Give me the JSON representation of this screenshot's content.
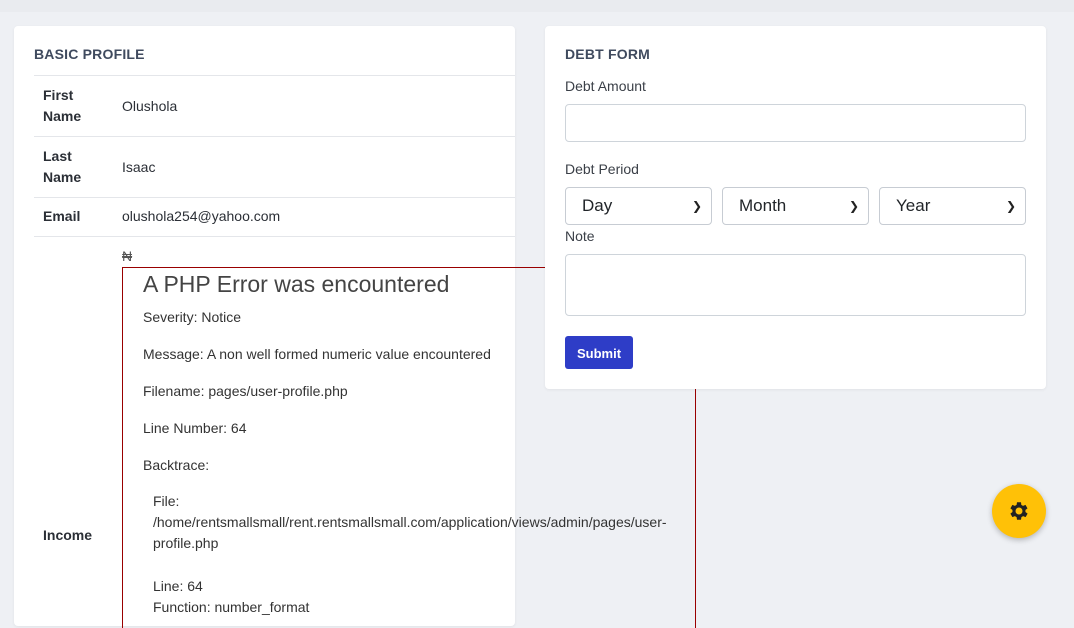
{
  "profile": {
    "title": "BASIC PROFILE",
    "rows": [
      {
        "label": "First Name",
        "value": "Olushola"
      },
      {
        "label": "Last Name",
        "value": "Isaac"
      },
      {
        "label": "Email",
        "value": "olushola254@yahoo.com"
      },
      {
        "label": "Income",
        "value": "₦"
      }
    ]
  },
  "php_error": {
    "title": "A PHP Error was encountered",
    "severity": "Severity: Notice",
    "message": "Message: A non well formed numeric value encountered",
    "filename": "Filename: pages/user-profile.php",
    "line_number": "Line Number: 64",
    "backtrace_label": "Backtrace:",
    "backtrace": {
      "file_label": "File:",
      "file_path": "/home/rentsmallsmall/rent.rentsmallsmall.com/application/views/admin/pages/user-profile.php",
      "line": "Line: 64",
      "function": "Function: number_format"
    }
  },
  "debt_form": {
    "title": "DEBT FORM",
    "amount_label": "Debt Amount",
    "amount_value": "",
    "period_label": "Debt Period",
    "day_select": "Day",
    "month_select": "Month",
    "year_select": "Year",
    "note_label": "Note",
    "note_value": "",
    "submit_label": "Submit"
  },
  "settings_fab": {
    "icon": "gear-icon",
    "color": "#ffc107"
  },
  "colors": {
    "primary": "#2e3dc7",
    "error_border": "#990000",
    "background": "#eef0f4"
  }
}
